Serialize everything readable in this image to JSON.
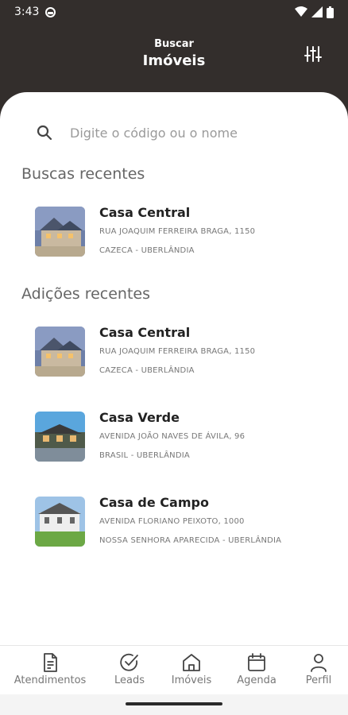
{
  "status_bar": {
    "time": "3:43"
  },
  "header": {
    "subtitle": "Buscar",
    "title": "Imóveis"
  },
  "search": {
    "placeholder": "Digite o código ou o nome"
  },
  "recent_searches": {
    "title": "Buscas recentes",
    "items": [
      {
        "name": "Casa Central",
        "address": "RUA JOAQUIM FERREIRA BRAGA, 1150",
        "location": "CAZECA - UBERLÂNDIA"
      }
    ]
  },
  "recent_additions": {
    "title": "Adições recentes",
    "items": [
      {
        "name": "Casa Central",
        "address": "RUA JOAQUIM FERREIRA BRAGA, 1150",
        "location": "CAZECA - UBERLÂNDIA"
      },
      {
        "name": "Casa Verde",
        "address": "AVENIDA JOÃO NAVES DE ÁVILA, 96",
        "location": "BRASIL - UBERLÂNDIA"
      },
      {
        "name": "Casa de Campo",
        "address": "AVENIDA FLORIANO PEIXOTO, 1000",
        "location": "NOSSA SENHORA APARECIDA - UBERLÂNDIA"
      }
    ]
  },
  "bottom_nav": {
    "items": [
      {
        "label": "Atendimentos",
        "icon": "document-icon"
      },
      {
        "label": "Leads",
        "icon": "check-circle-icon"
      },
      {
        "label": "Imóveis",
        "icon": "house-icon"
      },
      {
        "label": "Agenda",
        "icon": "calendar-icon"
      },
      {
        "label": "Perfil",
        "icon": "person-icon"
      }
    ]
  },
  "colors": {
    "header_bg": "#332e2c",
    "text_primary": "#222222",
    "text_secondary": "#777777"
  }
}
